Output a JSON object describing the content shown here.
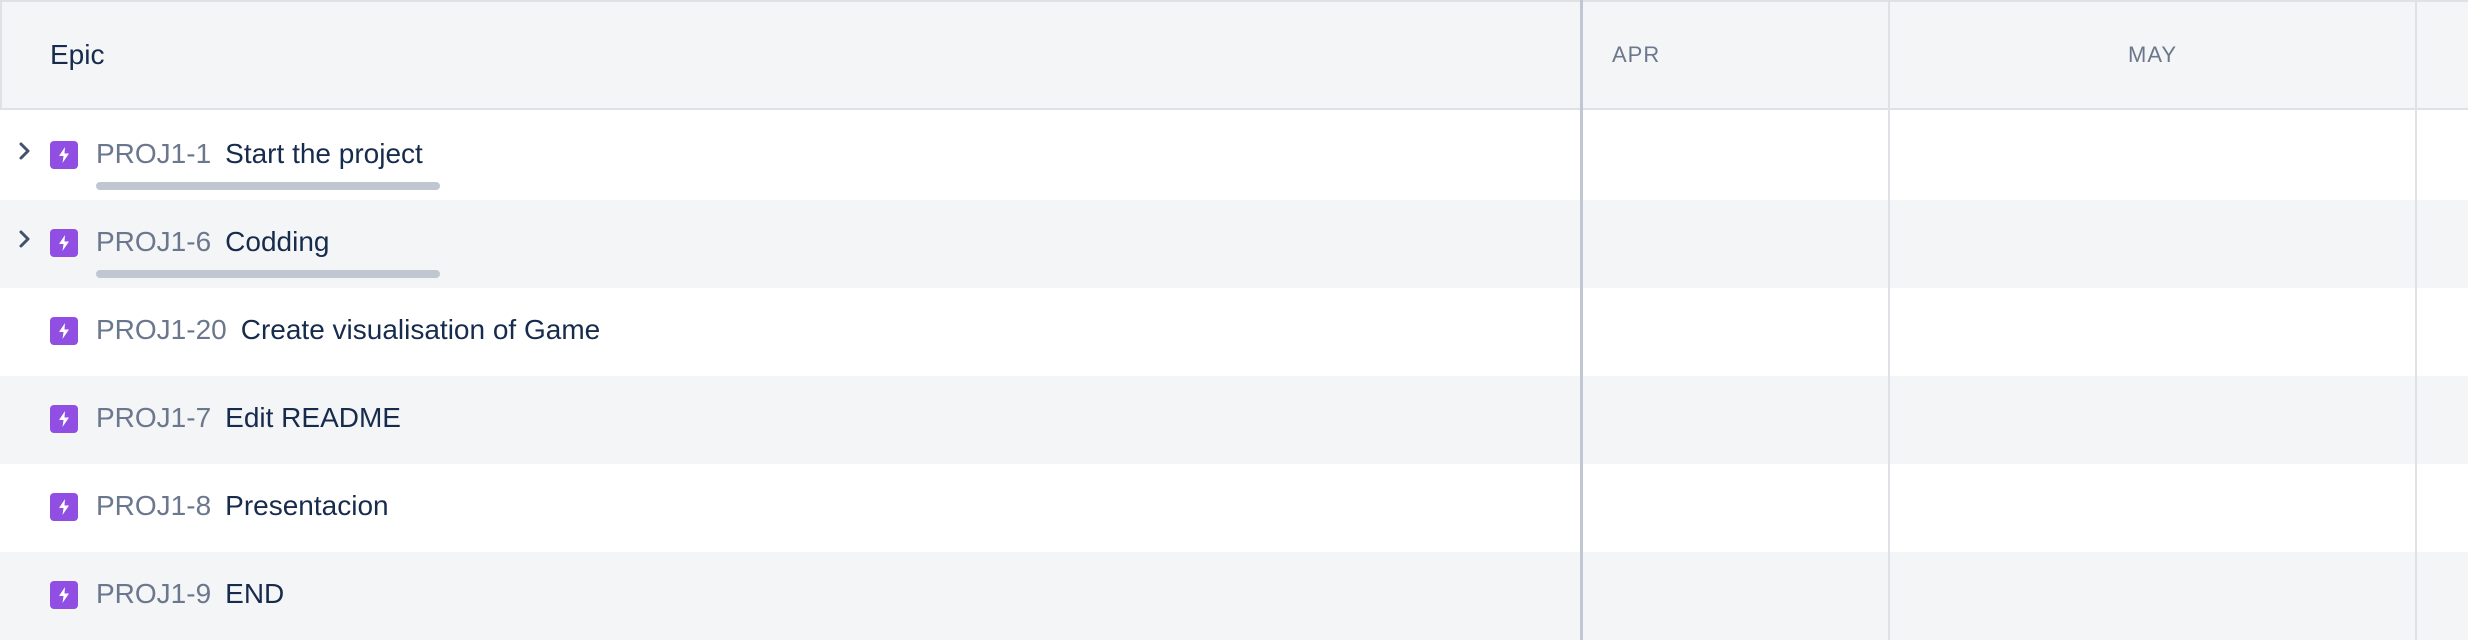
{
  "header": {
    "epic_label": "Epic",
    "months": [
      "APR",
      "MAY"
    ]
  },
  "rows": [
    {
      "key": "PROJ1-1",
      "summary": "Start the project",
      "expandable": true,
      "has_progress": true
    },
    {
      "key": "PROJ1-6",
      "summary": "Codding",
      "expandable": true,
      "has_progress": true
    },
    {
      "key": "PROJ1-20",
      "summary": "Create visualisation of Game",
      "expandable": false,
      "has_progress": false
    },
    {
      "key": "PROJ1-7",
      "summary": "Edit README",
      "expandable": false,
      "has_progress": false
    },
    {
      "key": "PROJ1-8",
      "summary": "Presentacion",
      "expandable": false,
      "has_progress": false
    },
    {
      "key": "PROJ1-9",
      "summary": "END",
      "expandable": false,
      "has_progress": false
    }
  ],
  "icons": {
    "epic": "lightning-bolt-icon",
    "expand": "chevron-right-icon"
  },
  "colors": {
    "epic_icon": "#904ee2",
    "header_bg": "#f4f5f7",
    "alt_row_bg": "#f4f5f7",
    "key_text": "#6b778c",
    "summary_text": "#172b4d",
    "progress_bar": "#c1c7d0"
  }
}
